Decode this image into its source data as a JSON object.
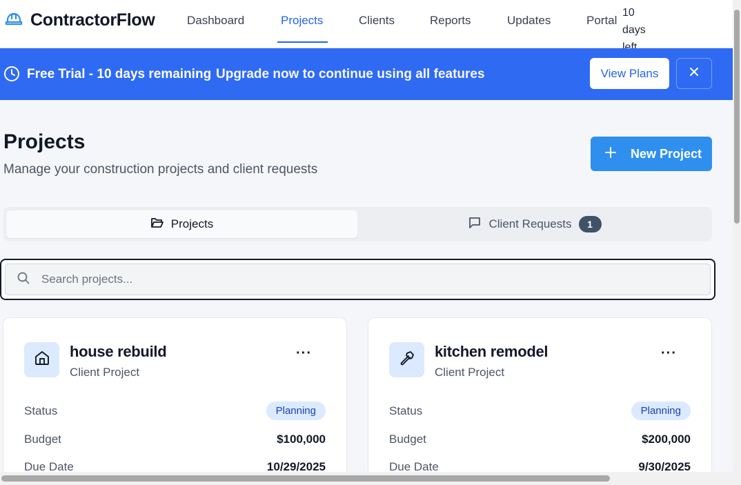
{
  "app": {
    "name": "ContractorFlow",
    "logo_icon": "hard-hat-icon"
  },
  "nav": {
    "items": [
      {
        "label": "Dashboard",
        "active": false
      },
      {
        "label": "Projects",
        "active": true
      },
      {
        "label": "Clients",
        "active": false
      },
      {
        "label": "Reports",
        "active": false
      },
      {
        "label": "Updates",
        "active": false
      },
      {
        "label": "Portal",
        "active": false
      }
    ],
    "trial_days_left": "10 days left"
  },
  "banner": {
    "icon": "clock-icon",
    "title": "Free Trial - 10 days remaining",
    "message": "Upgrade now to continue using all features",
    "cta_label": "View Plans",
    "close_icon": "close-icon",
    "color": "#2f6af2"
  },
  "page": {
    "title": "Projects",
    "subtitle": "Manage your construction projects and client requests",
    "new_button_label": "New Project"
  },
  "tabs": [
    {
      "label": "Projects",
      "icon": "folder-open-icon",
      "active": true
    },
    {
      "label": "Client Requests",
      "icon": "message-square-icon",
      "active": false,
      "badge": "1"
    }
  ],
  "search": {
    "placeholder": "Search projects...",
    "value": ""
  },
  "projects": [
    {
      "name": "house rebuild",
      "type": "Client Project",
      "icon": "home-icon",
      "status_label": "Status",
      "status": "Planning",
      "budget_label": "Budget",
      "budget": "$100,000",
      "due_label": "Due Date",
      "due_date": "10/29/2025"
    },
    {
      "name": "kitchen remodel",
      "type": "Client Project",
      "icon": "hammer-icon",
      "status_label": "Status",
      "status": "Planning",
      "budget_label": "Budget",
      "budget": "$200,000",
      "due_label": "Due Date",
      "due_date": "9/30/2025"
    }
  ],
  "colors": {
    "accent": "#2563eb",
    "primary_button": "#2f8fef",
    "status_pill_bg": "#dbeafe",
    "status_pill_text": "#1e40af"
  }
}
